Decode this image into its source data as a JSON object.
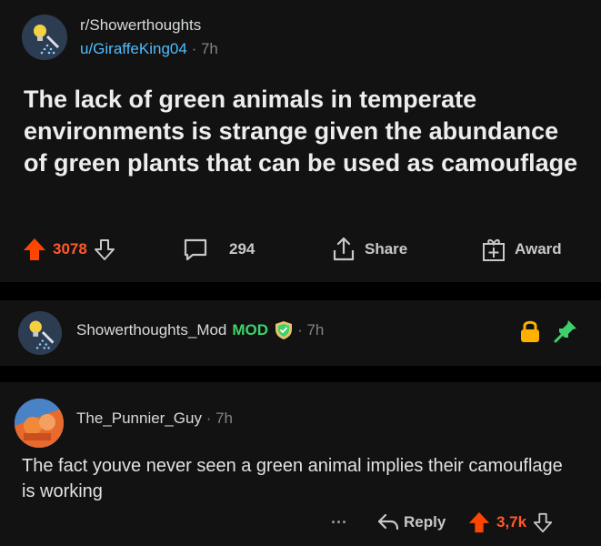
{
  "post": {
    "subreddit": "r/Showerthoughts",
    "author": "u/GiraffeKing04",
    "separator": "·",
    "age": "7h",
    "title": "The lack of green animals in temperate environments is strange given the abundance of green plants that can be used as camouflage",
    "score": "3078",
    "comments_count": "294",
    "share_label": "Share",
    "award_label": "Award",
    "vote_color": "#ff4500",
    "icons": [
      "upvote-icon",
      "downvote-icon",
      "comment-bubble-icon",
      "share-icon",
      "award-icon"
    ]
  },
  "mod_comment": {
    "author": "Showerthoughts_Mod",
    "badge": "MOD",
    "time": "· 7h",
    "mod_color": "#3dd16b",
    "icons": [
      "shield-icon",
      "lock-icon",
      "pin-icon"
    ]
  },
  "comment": {
    "author": "The_Punnier_Guy",
    "time": "· 7h",
    "body": "The fact youve never seen a green animal implies their camouflage is working",
    "more_label": "···",
    "reply_label": "Reply",
    "score": "3,7k"
  }
}
